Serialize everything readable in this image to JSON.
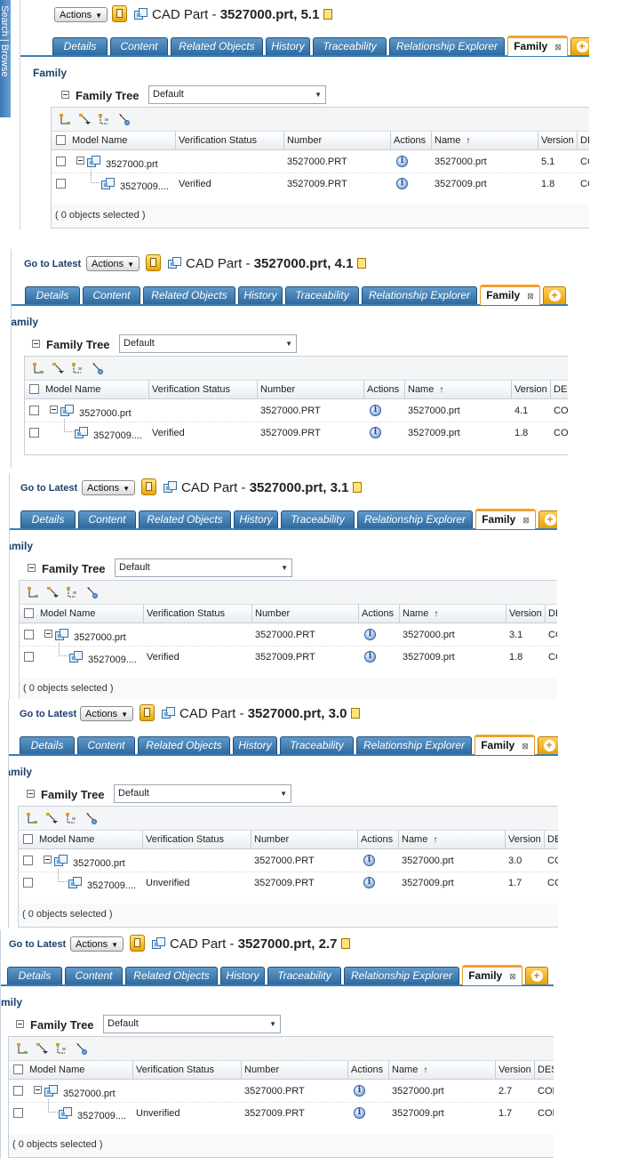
{
  "sidebar_strip_text": "Search | Browse",
  "panels": [
    {
      "goto_label": "",
      "actions_label": "Actions",
      "title_prefix": "CAD Part - ",
      "title_bold": "3527000.prt, 5.1",
      "tabs": [
        "Details",
        "Content",
        "Related Objects",
        "History",
        "Traceability",
        "Relationship Explorer",
        "Family"
      ],
      "family_label": "Family",
      "family_tree_label": "Family Tree",
      "family_tree_select": "Default",
      "columns": [
        "Model Name",
        "Verification Status",
        "Number",
        "Actions",
        "Name",
        "Version",
        "DESCR"
      ],
      "rows": [
        {
          "model_name": "3527000.prt",
          "verification": "",
          "number": "3527000.PRT",
          "name": "3527000.prt",
          "version": "5.1",
          "desc": "COMP"
        },
        {
          "model_name": "3527009....",
          "verification": "Verified",
          "number": "3527009.PRT",
          "name": "3527009.prt",
          "version": "1.8",
          "desc": "COMP"
        }
      ],
      "footer": "( 0 objects selected )"
    },
    {
      "goto_label": "Go to Latest",
      "actions_label": "Actions",
      "title_prefix": "CAD Part - ",
      "title_bold": "3527000.prt, 4.1",
      "tabs": [
        "Details",
        "Content",
        "Related Objects",
        "History",
        "Traceability",
        "Relationship Explorer",
        "Family"
      ],
      "family_label": "Family",
      "family_tree_label": "Family Tree",
      "family_tree_select": "Default",
      "columns": [
        "Model Name",
        "Verification Status",
        "Number",
        "Actions",
        "Name",
        "Version",
        "DES"
      ],
      "rows": [
        {
          "model_name": "3527000.prt",
          "verification": "",
          "number": "3527000.PRT",
          "name": "3527000.prt",
          "version": "4.1",
          "desc": "COM"
        },
        {
          "model_name": "3527009....",
          "verification": "Verified",
          "number": "3527009.PRT",
          "name": "3527009.prt",
          "version": "1.8",
          "desc": "COM"
        }
      ],
      "footer": ""
    },
    {
      "goto_label": "Go to Latest",
      "actions_label": "Actions",
      "title_prefix": "CAD Part - ",
      "title_bold": "3527000.prt, 3.1",
      "tabs": [
        "Details",
        "Content",
        "Related Objects",
        "History",
        "Traceability",
        "Relationship Explorer",
        "Family"
      ],
      "family_label": "Family",
      "family_tree_label": "Family Tree",
      "family_tree_select": "Default",
      "columns": [
        "Model Name",
        "Verification Status",
        "Number",
        "Actions",
        "Name",
        "Version",
        "DE"
      ],
      "rows": [
        {
          "model_name": "3527000.prt",
          "verification": "",
          "number": "3527000.PRT",
          "name": "3527000.prt",
          "version": "3.1",
          "desc": "CC"
        },
        {
          "model_name": "3527009....",
          "verification": "Verified",
          "number": "3527009.PRT",
          "name": "3527009.prt",
          "version": "1.8",
          "desc": "CC"
        }
      ],
      "footer": "( 0 objects selected )"
    },
    {
      "goto_label": "Go to Latest",
      "actions_label": "Actions",
      "title_prefix": "CAD Part - ",
      "title_bold": "3527000.prt, 3.0",
      "tabs": [
        "Details",
        "Content",
        "Related Objects",
        "History",
        "Traceability",
        "Relationship Explorer",
        "Family"
      ],
      "family_label": "Family",
      "family_tree_label": "Family Tree",
      "family_tree_select": "Default",
      "columns": [
        "Model Name",
        "Verification Status",
        "Number",
        "Actions",
        "Name",
        "Version",
        "DE"
      ],
      "rows": [
        {
          "model_name": "3527000.prt",
          "verification": "",
          "number": "3527000.PRT",
          "name": "3527000.prt",
          "version": "3.0",
          "desc": "CC"
        },
        {
          "model_name": "3527009....",
          "verification": "Unverified",
          "number": "3527009.PRT",
          "name": "3527009.prt",
          "version": "1.7",
          "desc": "CC"
        }
      ],
      "footer": "( 0 objects selected )"
    },
    {
      "goto_label": "Go to Latest",
      "actions_label": "Actions",
      "title_prefix": "CAD Part - ",
      "title_bold": "3527000.prt, 2.7",
      "tabs": [
        "Details",
        "Content",
        "Related Objects",
        "History",
        "Traceability",
        "Relationship Explorer",
        "Family"
      ],
      "family_label": "Family",
      "family_tree_label": "Family Tree",
      "family_tree_select": "Default",
      "columns": [
        "Model Name",
        "Verification Status",
        "Number",
        "Actions",
        "Name",
        "Version",
        "DES"
      ],
      "rows": [
        {
          "model_name": "3527000.prt",
          "verification": "",
          "number": "3527000.PRT",
          "name": "3527000.prt",
          "version": "2.7",
          "desc": "COM"
        },
        {
          "model_name": "3527009....",
          "verification": "Unverified",
          "number": "3527009.PRT",
          "name": "3527009.prt",
          "version": "1.7",
          "desc": "COM"
        }
      ],
      "footer": "( 0 objects selected )"
    }
  ]
}
